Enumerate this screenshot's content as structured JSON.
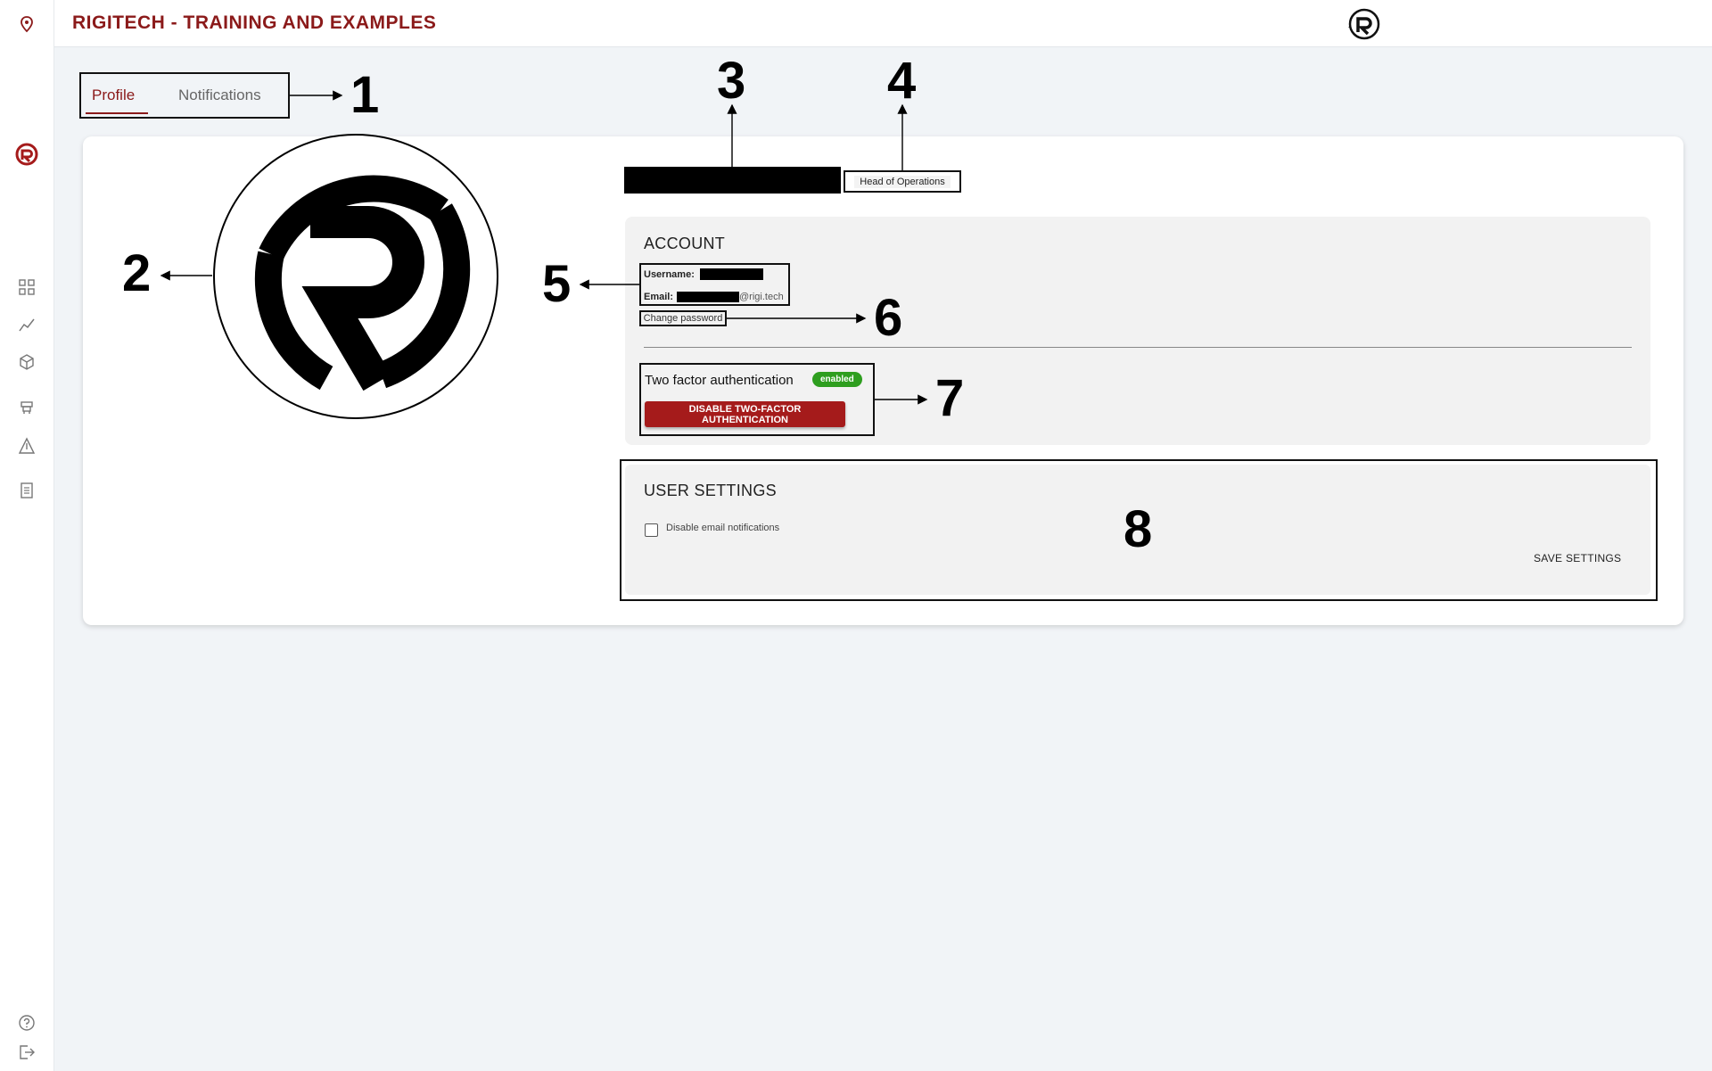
{
  "header": {
    "title": "RIGITECH - TRAINING AND EXAMPLES",
    "bell_icon": "bell-icon",
    "avatar_icon": "rigitech-logo-icon"
  },
  "sidebar": {
    "items": [
      {
        "icon": "location-pin-icon"
      },
      {
        "icon": "rigitech-logo-icon"
      },
      {
        "icon": "dashboard-grid-icon"
      },
      {
        "icon": "chart-line-icon"
      },
      {
        "icon": "box-cube-icon"
      },
      {
        "icon": "drone-icon"
      },
      {
        "icon": "warning-triangle-icon"
      },
      {
        "icon": "document-list-icon"
      },
      {
        "icon": "help-circle-icon"
      },
      {
        "icon": "logout-icon"
      }
    ]
  },
  "tabs": {
    "profile": "Profile",
    "notifications": "Notifications"
  },
  "annotations": [
    "1",
    "2",
    "3",
    "4",
    "5",
    "6",
    "7",
    "8"
  ],
  "profile": {
    "role": "Head of Operations"
  },
  "account": {
    "title": "ACCOUNT",
    "username_label": "Username:",
    "email_label": "Email:",
    "email_domain": "@rigi.tech",
    "change_password": "Change password",
    "tfa_label": "Two factor authentication",
    "tfa_status": "enabled",
    "tfa_button": "DISABLE TWO-FACTOR AUTHENTICATION"
  },
  "user_settings": {
    "title": "USER SETTINGS",
    "disable_email_label": "Disable email notifications",
    "disable_email_checked": false,
    "save_button": "SAVE SETTINGS"
  },
  "colors": {
    "brand": "#8b1a1a",
    "button_red": "#a51b1b",
    "enabled_green": "#2e9e1f",
    "background": "#f1f4f7",
    "panel": "#f2f2f2"
  }
}
